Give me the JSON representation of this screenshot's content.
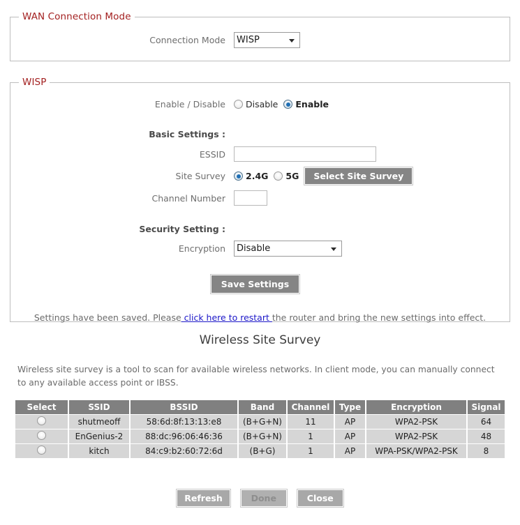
{
  "wan_panel": {
    "legend": "WAN  Connection Mode",
    "connection_mode_label": "Connection Mode",
    "connection_mode_value": "WISP",
    "connection_mode_options": [
      "WISP"
    ]
  },
  "wisp_panel": {
    "legend": "WISP",
    "enable_disable_label": "Enable / Disable",
    "disable_radio_label": "Disable",
    "enable_radio_label": "Enable",
    "enable_selected": "Enable",
    "basic_settings_heading": "Basic Settings  :",
    "essid_label": "ESSID",
    "essid_value": "",
    "essid_placeholder": "",
    "site_survey_label": "Site Survey",
    "band_24g_label": "2.4G",
    "band_5g_label": "5G",
    "band_selected": "2.4G",
    "select_site_survey_button": "Select Site Survey",
    "channel_number_label": "Channel Number",
    "channel_number_value": "",
    "security_setting_heading": "Security Setting  :",
    "encryption_label": "Encryption",
    "encryption_value": "Disable",
    "encryption_options": [
      "Disable"
    ],
    "save_settings_button": "Save Settings",
    "status_prefix": "Settings have been saved. Please",
    "status_link": " click here to restart ",
    "status_suffix": "the router and bring the new settings into effect."
  },
  "survey": {
    "title": "Wireless Site Survey",
    "description": "Wireless site survey is a tool to scan for available wireless networks. In client mode, you can manually connect to any available access point or IBSS.",
    "columns": [
      "Select",
      "SSID",
      "BSSID",
      "Band",
      "Channel",
      "Type",
      "Encryption",
      "Signal"
    ],
    "rows": [
      {
        "selected": false,
        "ssid": "shutmeoff",
        "bssid": "58:6d:8f:13:13:e8",
        "band": "(B+G+N)",
        "channel": "11",
        "type": "AP",
        "encryption": "WPA2-PSK",
        "signal": "64"
      },
      {
        "selected": false,
        "ssid": "EnGenius-2",
        "bssid": "88:dc:96:06:46:36",
        "band": "(B+G+N)",
        "channel": "1",
        "type": "AP",
        "encryption": "WPA2-PSK",
        "signal": "48"
      },
      {
        "selected": false,
        "ssid": "kitch",
        "bssid": "84:c9:b2:60:72:6d",
        "band": "(B+G)",
        "channel": "1",
        "type": "AP",
        "encryption": "WPA-PSK/WPA2-PSK",
        "signal": "8"
      }
    ],
    "buttons": {
      "refresh": "Refresh",
      "done": "Done",
      "close": "Close",
      "done_disabled": true
    }
  },
  "colors": {
    "legend_red": "#a32020",
    "link_blue": "#1b16c8",
    "table_header_grey": "#808080",
    "table_row_grey": "#d6d6d6",
    "button_grey": "#858585",
    "radio_blue": "#1f6fb5"
  }
}
